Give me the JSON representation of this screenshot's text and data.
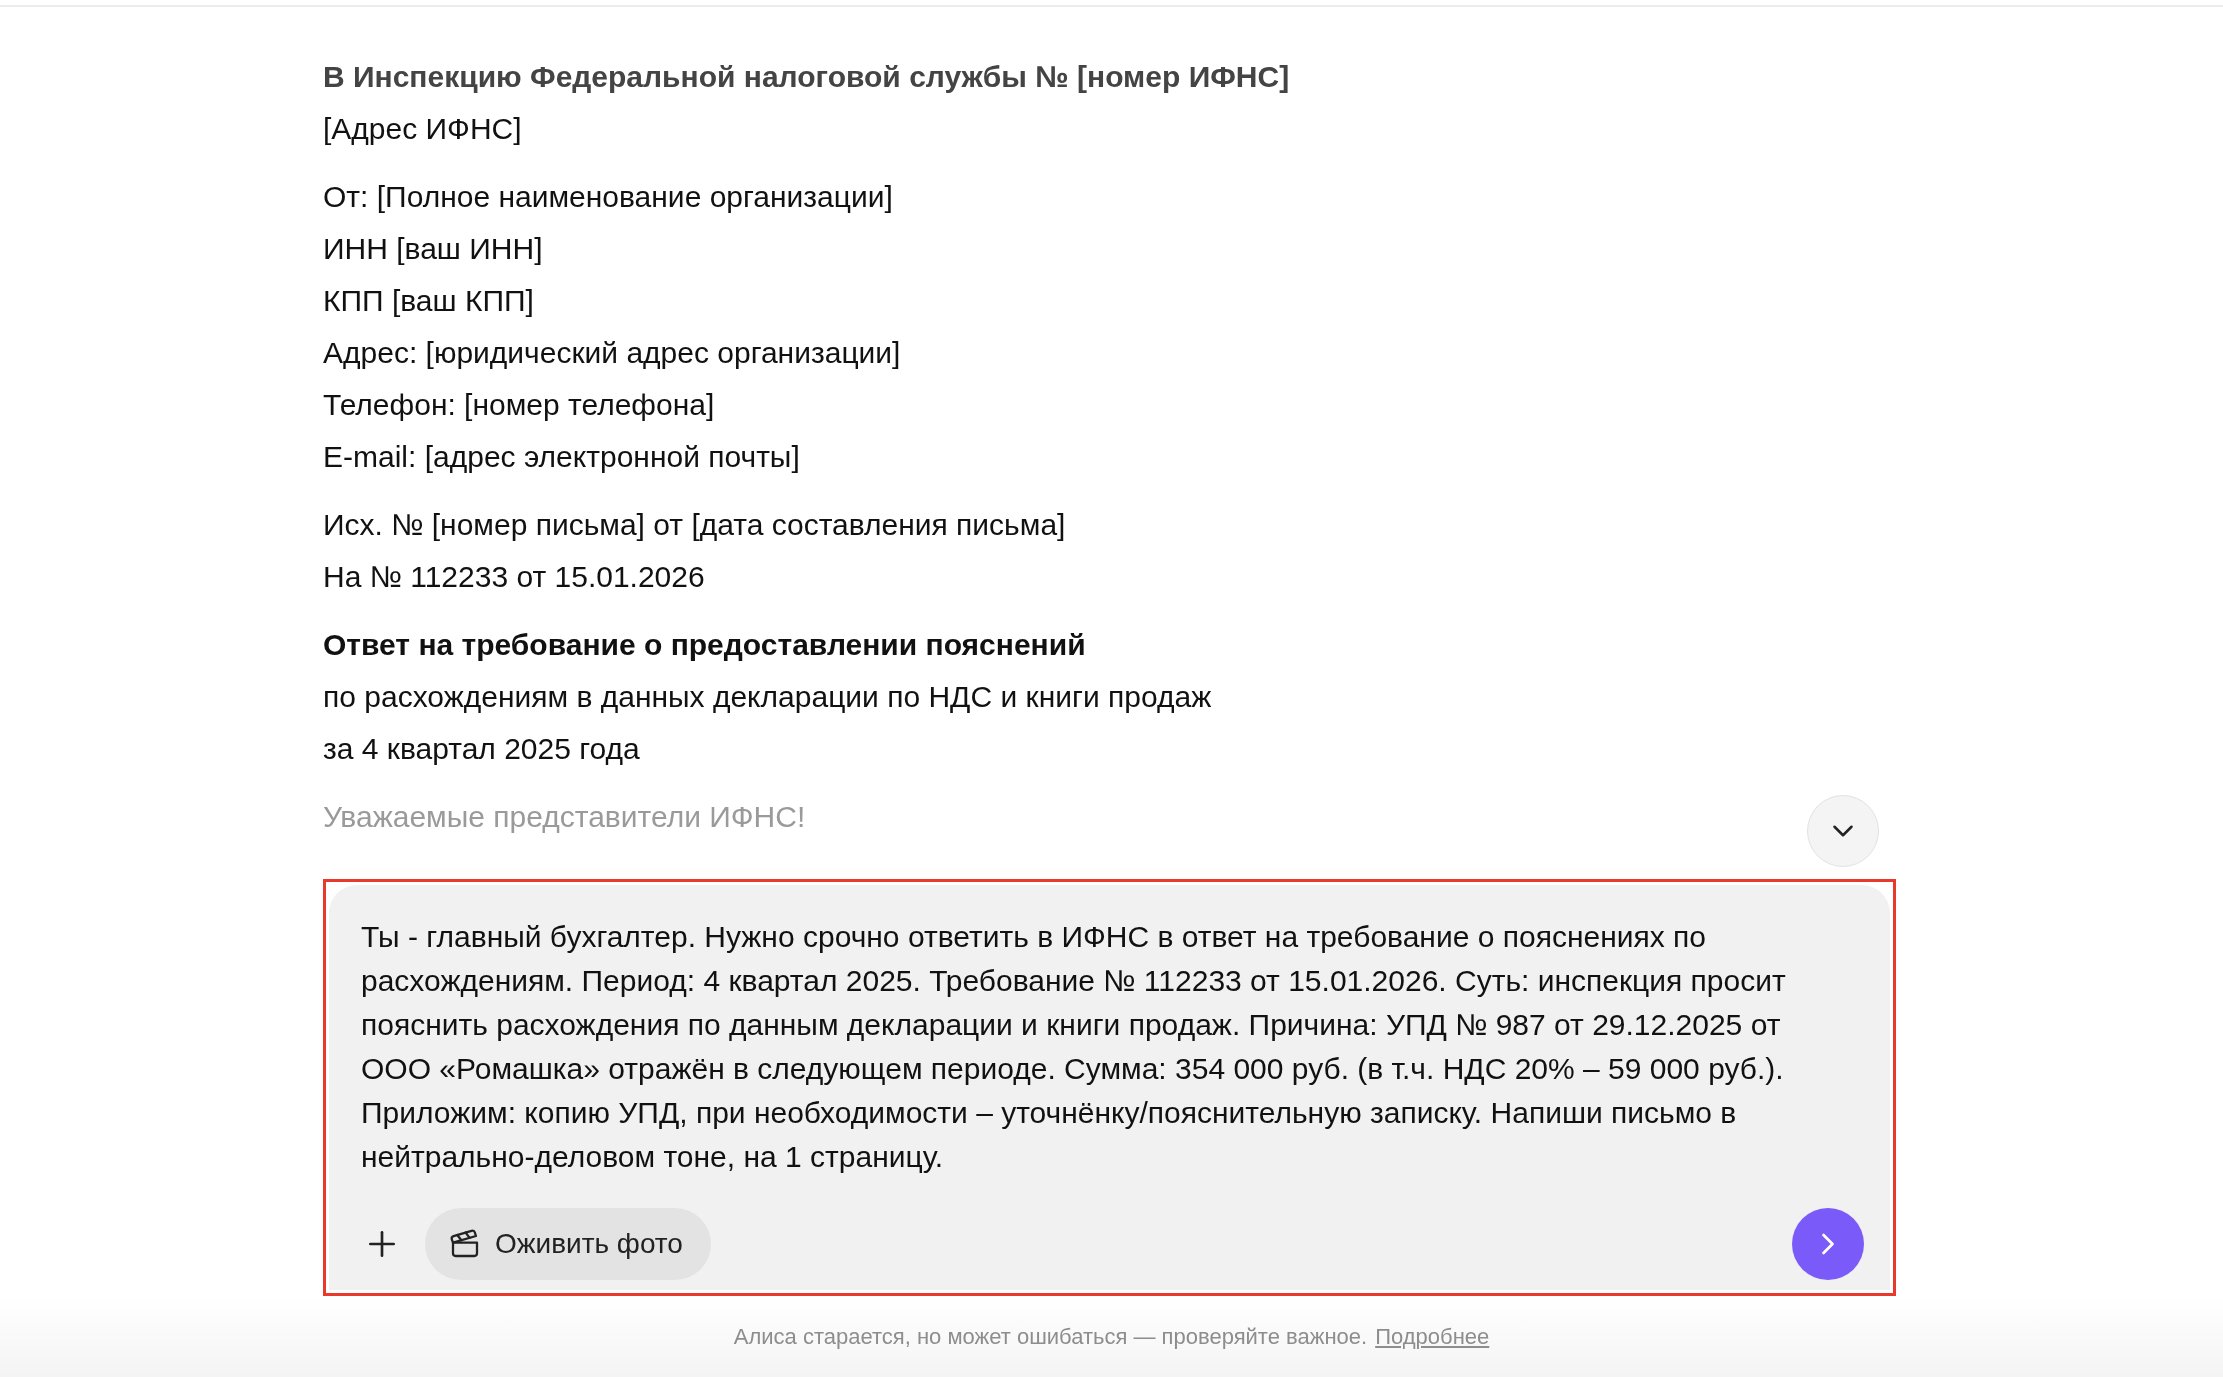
{
  "letter": {
    "blocks": [
      {
        "kind": "address",
        "lines": [
          {
            "text": "В Инспекцию Федеральной налоговой службы № [номер ИФНС]",
            "bold": true
          },
          {
            "text": "[Адрес ИФНС]",
            "bold": false
          }
        ]
      },
      {
        "kind": "plain",
        "lines": [
          {
            "text": "От: [Полное наименование организации]",
            "bold": false
          },
          {
            "text": "ИНН [ваш ИНН]",
            "bold": false
          },
          {
            "text": "КПП [ваш КПП]",
            "bold": false
          },
          {
            "text": "Адрес: [юридический адрес организации]",
            "bold": false
          },
          {
            "text": "Телефон: [номер телефона]",
            "bold": false
          },
          {
            "text": "E-mail: [адрес электронной почты]",
            "bold": false
          }
        ]
      },
      {
        "kind": "plain",
        "lines": [
          {
            "text": "Исх. № [номер письма] от [дата составления письма]",
            "bold": false
          },
          {
            "text": "На № 112233 от 15.01.2026",
            "bold": false
          }
        ]
      },
      {
        "kind": "title",
        "lines": [
          {
            "text": "Ответ на требование о предоставлении пояснений",
            "bold": true
          },
          {
            "text": "по расхождениям в данных декларации по НДС и книги продаж",
            "bold": false
          },
          {
            "text": "за 4 квартал 2025 года",
            "bold": false
          }
        ]
      },
      {
        "kind": "faded",
        "lines": [
          {
            "text": "Уважаемые представители ИФНС!",
            "bold": false
          }
        ]
      }
    ]
  },
  "composer": {
    "value": "Ты - главный бухгалтер. Нужно срочно ответить в ИФНС в ответ на требование о пояснениях по расхождениям. Период: 4 квартал 2025. Требование № 112233 от 15.01.2026. Суть: инспекция просит пояснить расхождения по данным декларации и книги продаж. Причина: УПД № 987 от 29.12.2025 от ООО «Ромашка» отражён в следующем периоде. Сумма: 354 000 руб. (в т.ч. НДС 20% – 59 000 руб.). Приложим: копию УПД, при необходимости – уточнёнку/пояснительную записку. Напиши письмо в нейтрально-деловом тоне, на 1 страницу.",
    "chip": "Оживить фото"
  },
  "footer": {
    "text": "Алиса старается, но может ошибаться — проверяйте важное.",
    "link": "Подробнее"
  }
}
